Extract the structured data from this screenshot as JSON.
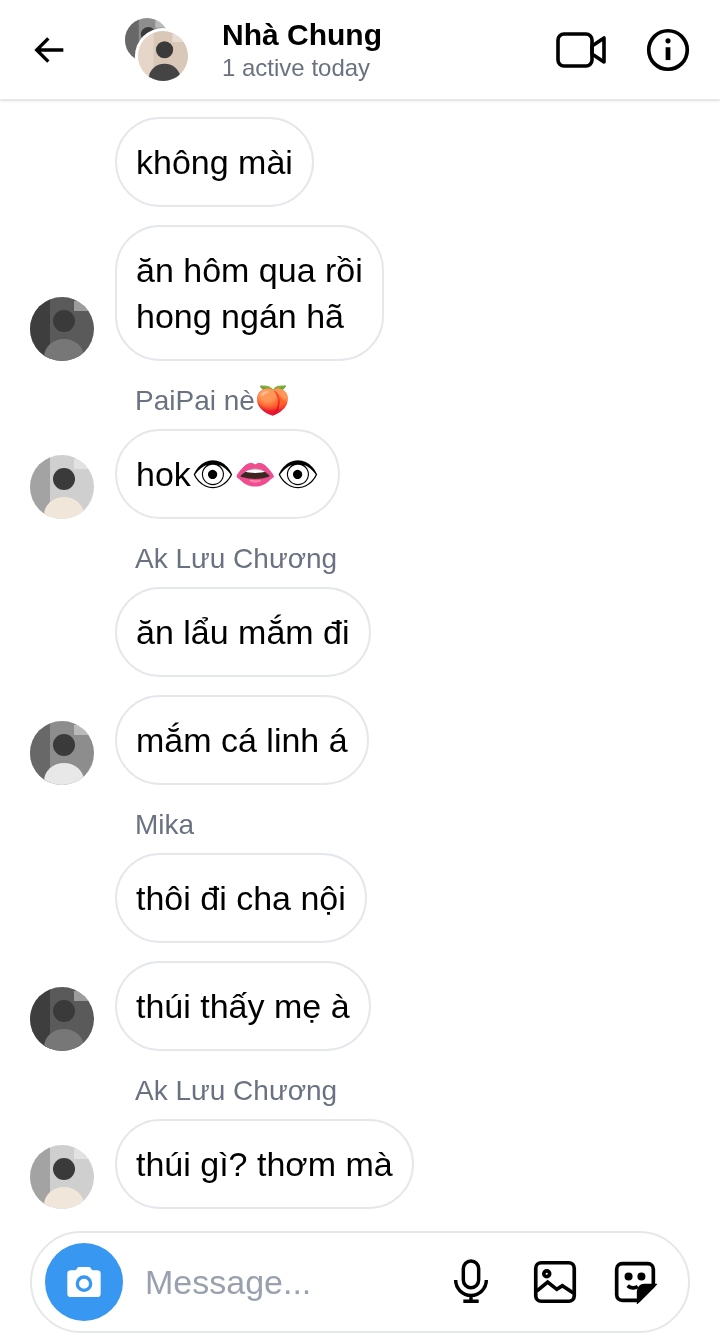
{
  "header": {
    "title": "Nhà Chung",
    "subtitle": "1 active today"
  },
  "groups": [
    {
      "messages": [
        {
          "text": "không mài",
          "avatar": false
        },
        {
          "text": "ăn hôm qua rồi\nhong ngán hã",
          "avatar": true
        }
      ]
    },
    {
      "sender": "PaiPai nè🍑",
      "messages": [
        {
          "text": "hok👁👄👁",
          "avatar": true
        }
      ]
    },
    {
      "sender": "Ak Lưu Chương",
      "messages": [
        {
          "text": "ăn lẩu mắm đi",
          "avatar": false
        },
        {
          "text": "mắm cá linh á",
          "avatar": true
        }
      ]
    },
    {
      "sender": "Mika",
      "messages": [
        {
          "text": "thôi đi cha nội",
          "avatar": false
        },
        {
          "text": "thúi thấy mẹ à",
          "avatar": true
        }
      ]
    },
    {
      "sender": "Ak Lưu Chương",
      "messages": [
        {
          "text": "thúi gì? thơm mà",
          "avatar": true
        }
      ]
    }
  ],
  "composer": {
    "placeholder": "Message..."
  }
}
